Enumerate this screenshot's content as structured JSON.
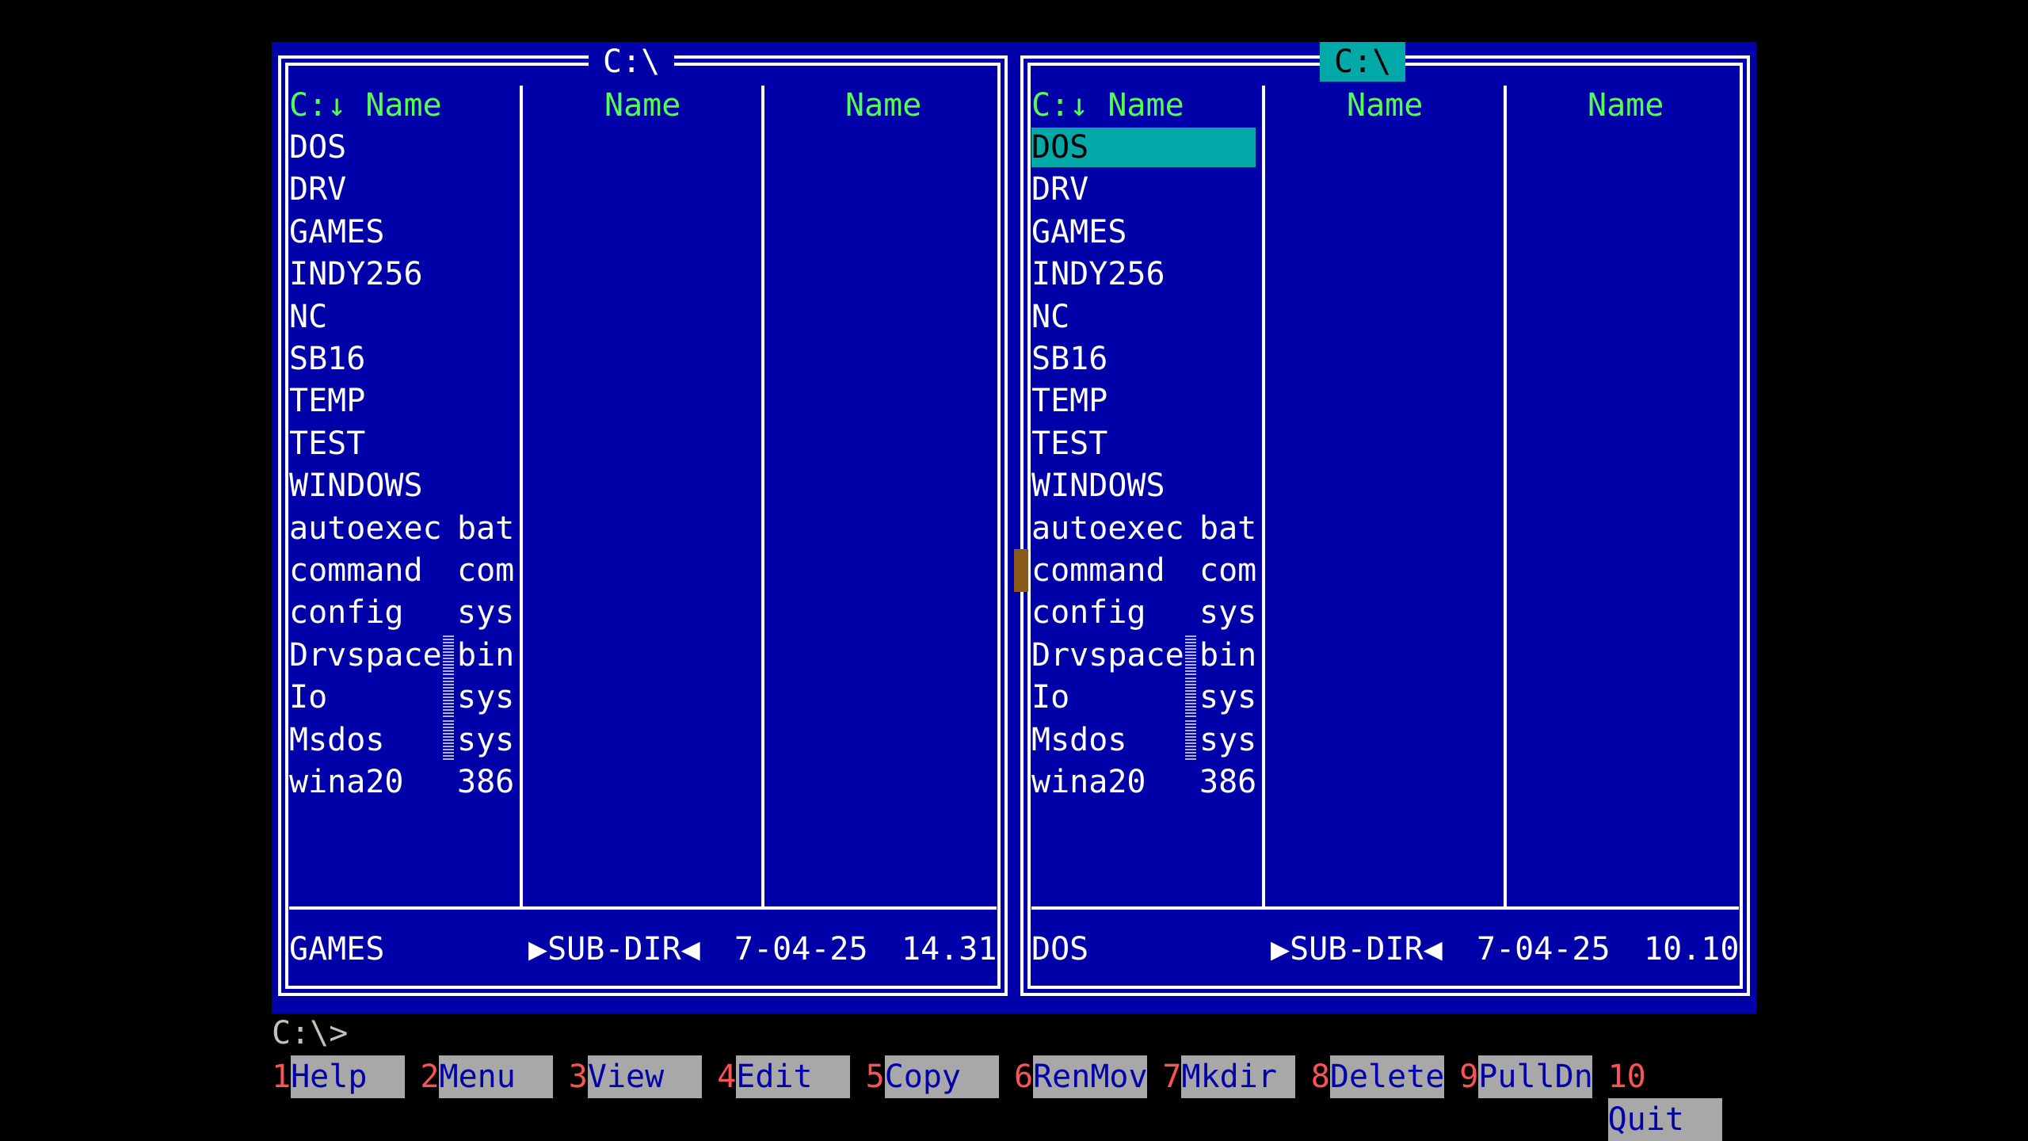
{
  "left_panel": {
    "title": "C:\\",
    "headers": [
      "C:↓ Name",
      "Name",
      "Name"
    ],
    "files": [
      {
        "name": "DOS",
        "ext": ""
      },
      {
        "name": "DRV",
        "ext": ""
      },
      {
        "name": "GAMES",
        "ext": ""
      },
      {
        "name": "INDY256",
        "ext": ""
      },
      {
        "name": "NC",
        "ext": ""
      },
      {
        "name": "SB16",
        "ext": ""
      },
      {
        "name": "TEMP",
        "ext": ""
      },
      {
        "name": "TEST",
        "ext": ""
      },
      {
        "name": "WINDOWS",
        "ext": ""
      },
      {
        "name": "autoexec",
        "ext": "bat"
      },
      {
        "name": "command",
        "ext": "com"
      },
      {
        "name": "config",
        "ext": "sys"
      },
      {
        "name": "Drvspace",
        "ext": "bin"
      },
      {
        "name": "Io",
        "ext": "sys"
      },
      {
        "name": "Msdos",
        "ext": "sys"
      },
      {
        "name": "wina20",
        "ext": "386"
      }
    ],
    "status": {
      "name": "GAMES",
      "type": "▶SUB-DIR◀",
      "date": "7-04-25",
      "time": "14.31"
    }
  },
  "right_panel": {
    "title": "C:\\",
    "headers": [
      "C:↓ Name",
      "Name",
      "Name"
    ],
    "files": [
      {
        "name": "DOS",
        "ext": ""
      },
      {
        "name": "DRV",
        "ext": ""
      },
      {
        "name": "GAMES",
        "ext": ""
      },
      {
        "name": "INDY256",
        "ext": ""
      },
      {
        "name": "NC",
        "ext": ""
      },
      {
        "name": "SB16",
        "ext": ""
      },
      {
        "name": "TEMP",
        "ext": ""
      },
      {
        "name": "TEST",
        "ext": ""
      },
      {
        "name": "WINDOWS",
        "ext": ""
      },
      {
        "name": "autoexec",
        "ext": "bat"
      },
      {
        "name": "command",
        "ext": "com"
      },
      {
        "name": "config",
        "ext": "sys"
      },
      {
        "name": "Drvspace",
        "ext": "bin"
      },
      {
        "name": "Io",
        "ext": "sys"
      },
      {
        "name": "Msdos",
        "ext": "sys"
      },
      {
        "name": "wina20",
        "ext": "386"
      }
    ],
    "status": {
      "name": "DOS",
      "type": "▶SUB-DIR◀",
      "date": "7-04-25",
      "time": "10.10"
    }
  },
  "command_line": {
    "prompt": "C:\\>"
  },
  "function_keys": [
    {
      "num": "1",
      "label": "Help"
    },
    {
      "num": "2",
      "label": "Menu"
    },
    {
      "num": "3",
      "label": "View"
    },
    {
      "num": "4",
      "label": "Edit"
    },
    {
      "num": "5",
      "label": "Copy"
    },
    {
      "num": "6",
      "label": "RenMov"
    },
    {
      "num": "7",
      "label": "Mkdir"
    },
    {
      "num": "8",
      "label": "Delete"
    },
    {
      "num": "9",
      "label": "PullDn"
    },
    {
      "num": "10",
      "label": "Quit"
    }
  ],
  "colors": {
    "panel_bg": "#0000a8",
    "header_green": "#54fc54",
    "selection": "#00a8a8",
    "fkey_num": "#fc5454",
    "fkey_bg": "#a8a8a8"
  }
}
